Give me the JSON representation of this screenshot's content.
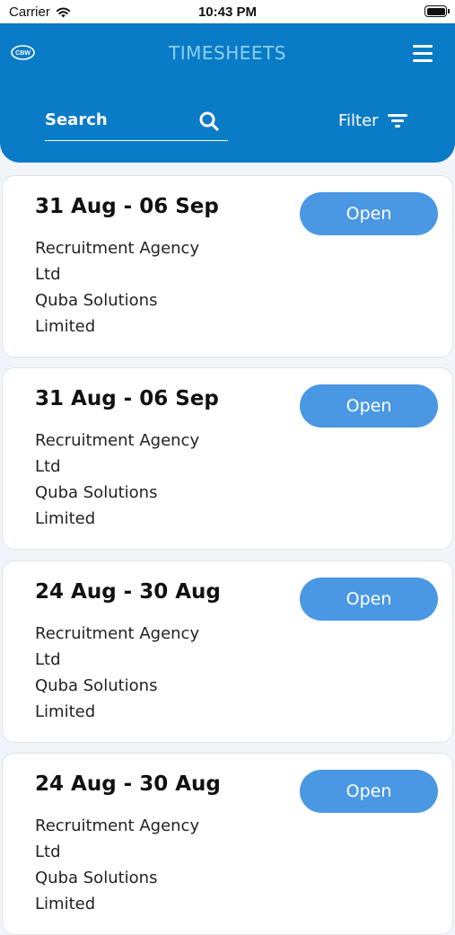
{
  "status_bar": {
    "carrier": "Carrier",
    "time": "10:43 PM"
  },
  "header": {
    "title": "TIMESHEETS",
    "search_label": "Search",
    "filter_label": "Filter",
    "logo_text": "CBW"
  },
  "cards": [
    {
      "date_range": "31 Aug - 06 Sep",
      "lines": [
        "Recruitment Agency",
        "Ltd",
        "Quba Solutions",
        "Limited"
      ],
      "button_label": "Open"
    },
    {
      "date_range": "31 Aug - 06 Sep",
      "lines": [
        "Recruitment Agency",
        "Ltd",
        "Quba Solutions",
        "Limited"
      ],
      "button_label": "Open"
    },
    {
      "date_range": "24 Aug - 30 Aug",
      "lines": [
        "Recruitment Agency",
        "Ltd",
        "Quba Solutions",
        "Limited"
      ],
      "button_label": "Open"
    },
    {
      "date_range": "24 Aug - 30 Aug",
      "lines": [
        "Recruitment Agency",
        "Ltd",
        "Quba Solutions",
        "Limited"
      ],
      "button_label": "Open"
    }
  ],
  "colors": {
    "header_bg": "#0a7bc6",
    "title": "#8fd0f4",
    "button_bg": "#4a98e3",
    "page_bg": "#f1f4f9"
  },
  "icons": {
    "wifi": "wifi-icon",
    "battery": "battery-icon",
    "logo": "app-logo",
    "menu": "hamburger-menu-icon",
    "search": "search-icon",
    "filter": "filter-icon"
  }
}
